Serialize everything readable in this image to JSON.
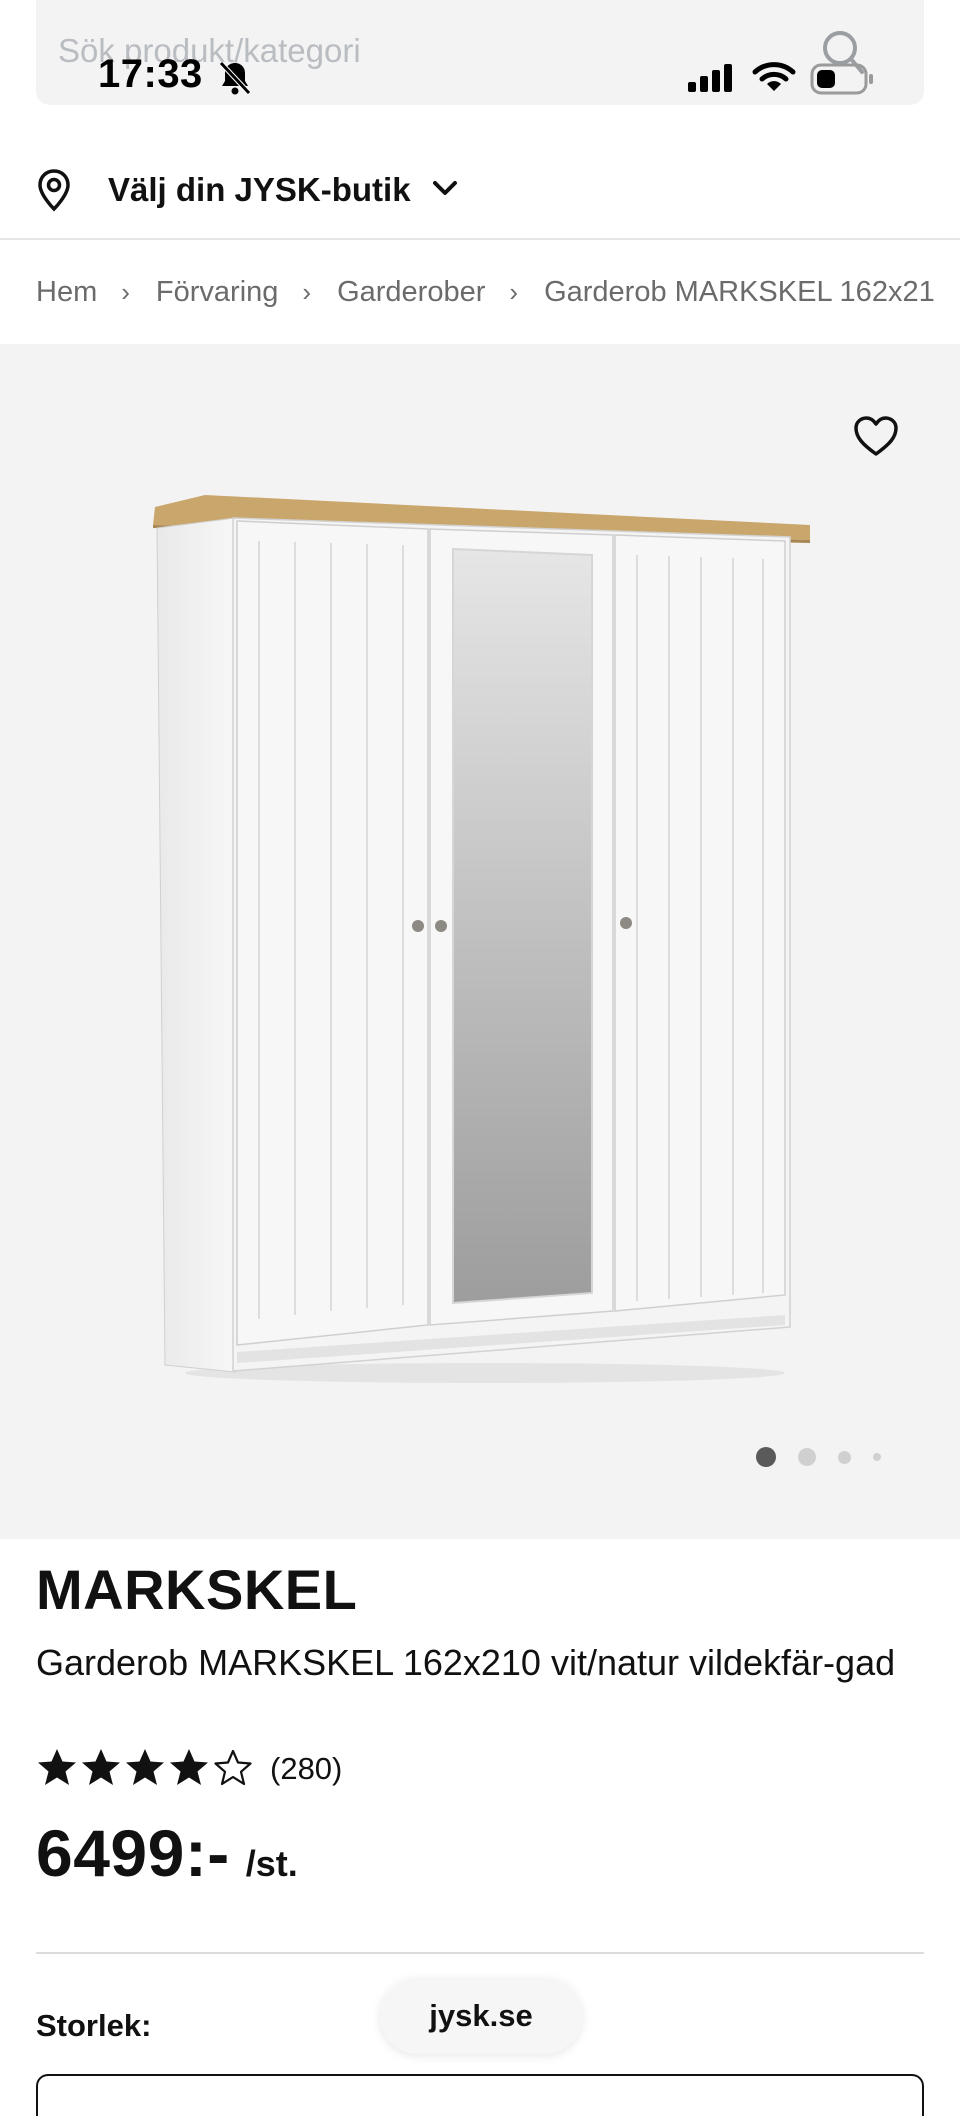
{
  "status_bar": {
    "time": "17:33"
  },
  "search": {
    "placeholder": "Sök produkt/kategori"
  },
  "store": {
    "label": "Välj din JYSK-butik"
  },
  "breadcrumb": [
    "Hem",
    "Förvaring",
    "Garderober",
    "Garderob MARKSKEL 162x21"
  ],
  "gallery": {
    "image_count": 4,
    "active_index": 0
  },
  "product": {
    "brand": "MARKSKEL",
    "title": "Garderob MARKSKEL 162x210 vit/natur vildekfär-gad",
    "rating": 4,
    "rating_max": 5,
    "review_count": "(280)",
    "price": "6499:-",
    "unit": "/st."
  },
  "options": {
    "size_label": "Storlek:"
  },
  "browser": {
    "url": "jysk.se"
  },
  "colors": {
    "image_background": "#f3f3f3",
    "text": "#111111",
    "muted": "#6b6b6b",
    "wood_top": "#c9a66b"
  },
  "icons": [
    "search-icon",
    "bell-off-icon",
    "signal-icon",
    "wifi-icon",
    "battery-icon",
    "pin-icon",
    "chevron-down-icon",
    "chevron-right-icon",
    "heart-icon",
    "star-icon"
  ]
}
